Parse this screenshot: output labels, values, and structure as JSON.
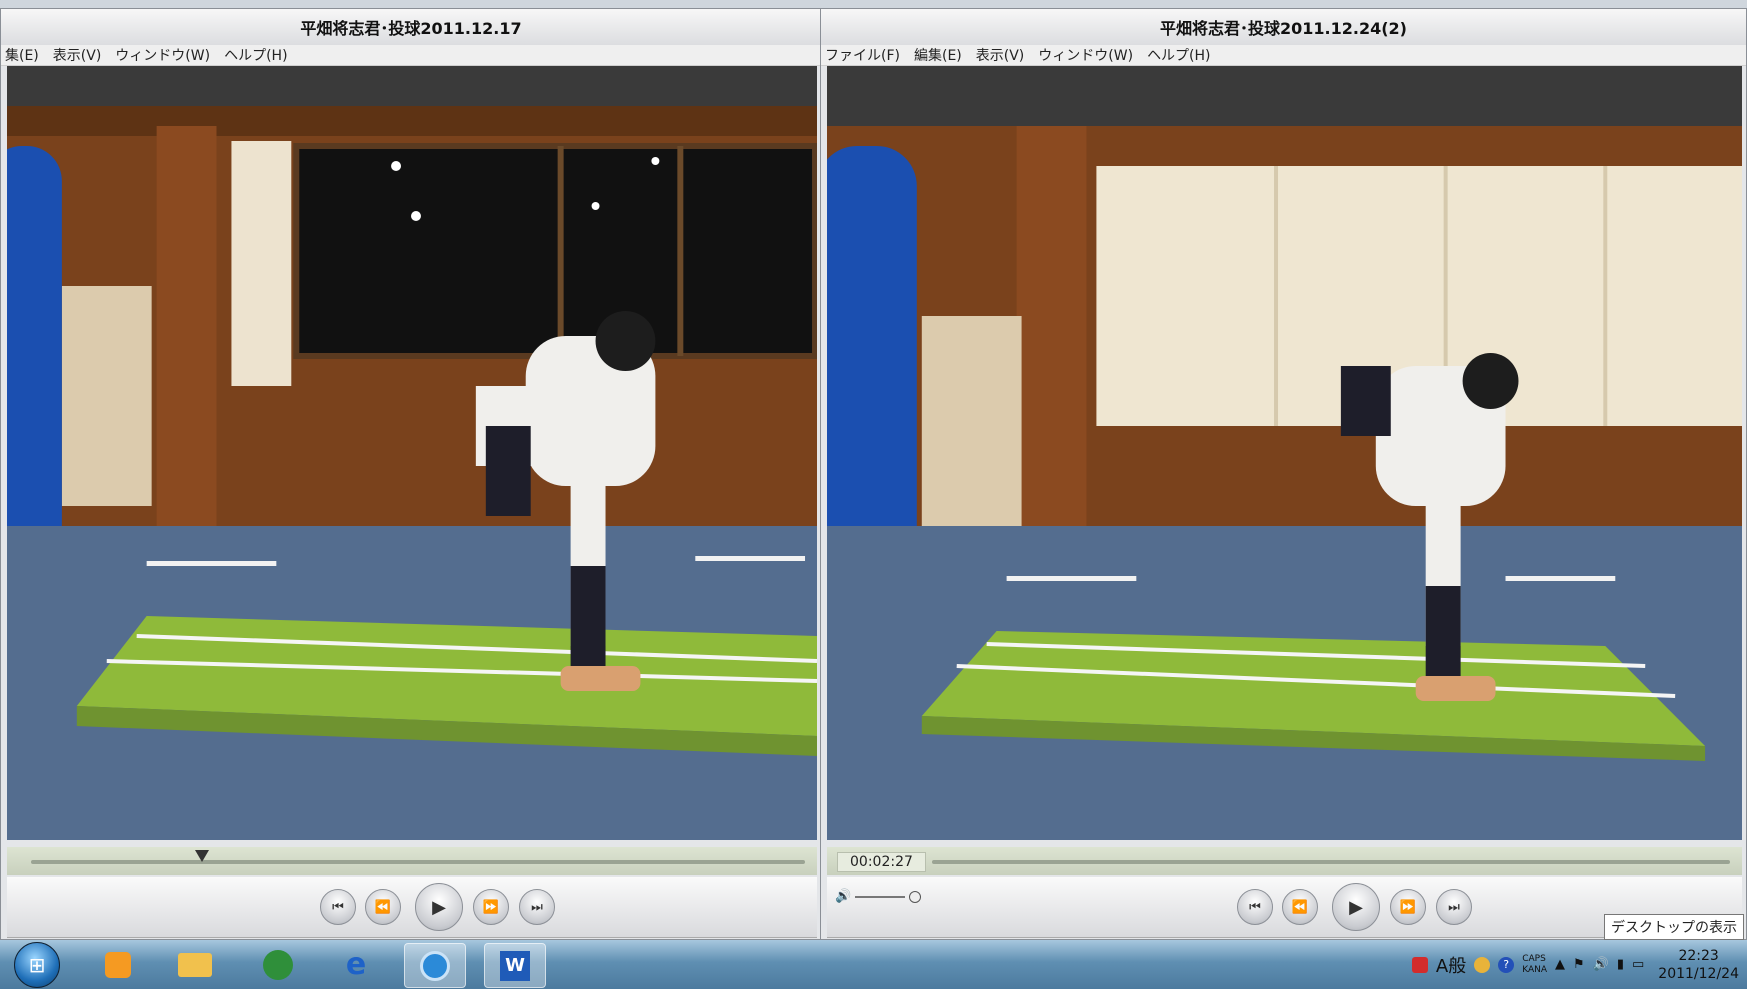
{
  "left_window": {
    "title": "平畑将志君･投球2011.12.17",
    "menu": [
      "集(E)",
      "表示(V)",
      "ウィンドウ(W)",
      "ヘルプ(H)"
    ]
  },
  "right_window": {
    "title": "平畑将志君･投球2011.12.24(2)",
    "menu": [
      "ファイル(F)",
      "編集(E)",
      "表示(V)",
      "ウィンドウ(W)",
      "ヘルプ(H)"
    ],
    "timecode": "00:02:27"
  },
  "player_controls": {
    "to_start": "⏮",
    "rewind": "⏪",
    "play": "▶",
    "fast_forward": "⏩",
    "to_end": "⏭",
    "volume_icon": "🔊"
  },
  "tooltip": "デスクトップの表示",
  "taskbar": {
    "apps": [
      "media-player-icon",
      "explorer-icon",
      "excel-icon",
      "ie-icon",
      "quicktime-icon",
      "word-icon"
    ],
    "tray": {
      "ime": "A般",
      "caps": "CAPS",
      "kana": "KANA",
      "time": "22:23",
      "date": "2011/12/24"
    }
  },
  "colors": {
    "mat_green": "#8fba3a",
    "floor_blue": "#546d8f",
    "wall_wood": "#7a421c",
    "punching_bag": "#1b4fb0"
  }
}
